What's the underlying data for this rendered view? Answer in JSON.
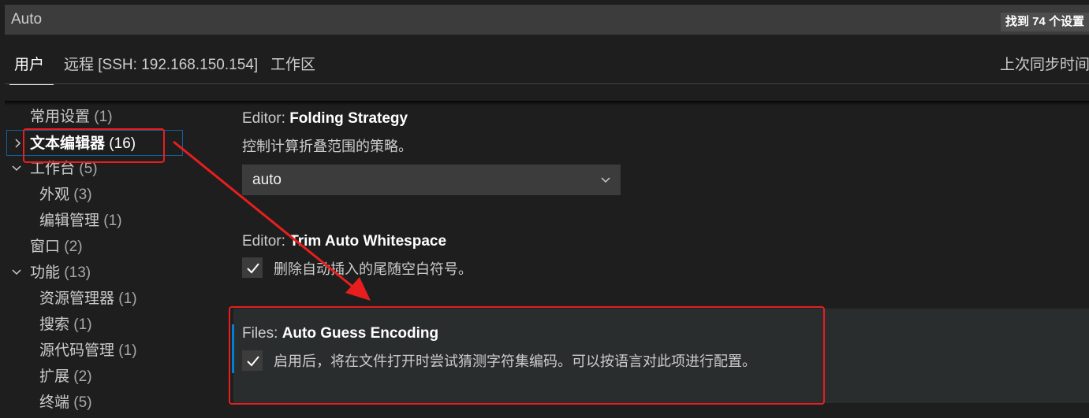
{
  "search": {
    "value": "Auto",
    "result_count": "找到 74 个设置"
  },
  "tabs": [
    {
      "label": "用户",
      "active": true
    },
    {
      "label": "远程 [SSH: 192.168.150.154]",
      "active": false
    },
    {
      "label": "工作区",
      "active": false
    }
  ],
  "sync_label": "上次同步时间",
  "tree": [
    {
      "label": "常用设置",
      "count": "(1)"
    },
    {
      "label": "文本编辑器",
      "count": "(16)"
    },
    {
      "label": "工作台",
      "count": "(5)"
    },
    {
      "label": "外观",
      "count": "(3)"
    },
    {
      "label": "编辑管理",
      "count": "(1)"
    },
    {
      "label": "窗口",
      "count": "(2)"
    },
    {
      "label": "功能",
      "count": "(13)"
    },
    {
      "label": "资源管理器",
      "count": "(1)"
    },
    {
      "label": "搜索",
      "count": "(1)"
    },
    {
      "label": "源代码管理",
      "count": "(1)"
    },
    {
      "label": "扩展",
      "count": "(2)"
    },
    {
      "label": "终端",
      "count": "(5)"
    }
  ],
  "settings": {
    "folding": {
      "category": "Editor: ",
      "name": "Folding Strategy",
      "description": "控制计算折叠范围的策略。",
      "value": "auto"
    },
    "trim": {
      "category": "Editor: ",
      "name": "Trim Auto Whitespace",
      "description": "删除自动插入的尾随空白符号。",
      "checked": true
    },
    "encoding": {
      "category": "Files: ",
      "name": "Auto Guess Encoding",
      "description": "启用后，将在文件打开时尝试猜测字符集编码。可以按语言对此项进行配置。",
      "checked": true
    }
  },
  "colors": {
    "background": "#1e1e1e",
    "input_bg": "#3c3c3c",
    "focus_accent": "#007fd4",
    "annotation_red": "#e81e1e"
  },
  "icons": {
    "check": "check-icon",
    "chevron_down": "chevron-down-icon",
    "chevron_right": "chevron-right-icon"
  }
}
